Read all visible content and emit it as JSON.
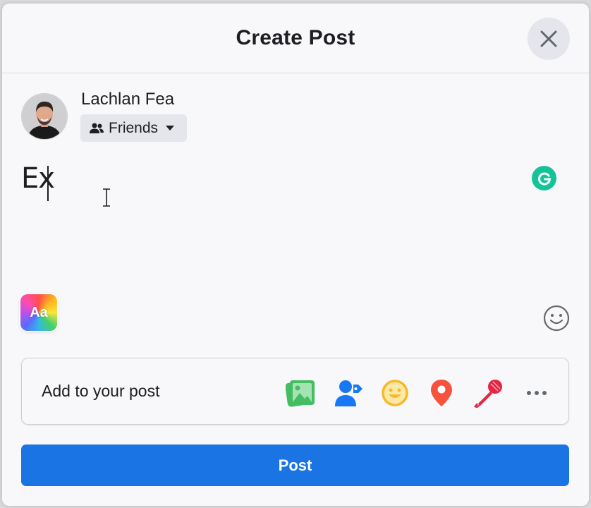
{
  "dialog": {
    "title": "Create Post",
    "close_icon": "close-icon"
  },
  "user": {
    "name": "Lachlan Fea",
    "avatar_icon": "user-avatar"
  },
  "audience": {
    "label": "Friends",
    "icon": "friends-icon",
    "dropdown_icon": "caret-down-icon"
  },
  "composer": {
    "value": "Ex",
    "grammarly_icon": "grammarly-icon",
    "background_picker_label": "Aa",
    "emoji_icon": "smiley-icon"
  },
  "add_to_post": {
    "label": "Add to your post",
    "items": [
      {
        "name": "photo-video",
        "icon": "photo-icon",
        "color": "#45bd62"
      },
      {
        "name": "tag-people",
        "icon": "tag-people-icon",
        "color": "#1877f2"
      },
      {
        "name": "feeling-activity",
        "icon": "feeling-icon",
        "color": "#f7b928"
      },
      {
        "name": "check-in",
        "icon": "location-pin-icon",
        "color": "#f5533d"
      },
      {
        "name": "live-video",
        "icon": "microphone-icon",
        "color": "#e42645"
      },
      {
        "name": "more",
        "icon": "more-icon",
        "color": "#606770"
      }
    ]
  },
  "actions": {
    "post_label": "Post"
  },
  "colors": {
    "primary": "#1b74e4",
    "surface": "#f8f7fa",
    "button_bg": "#e4e6eb"
  }
}
